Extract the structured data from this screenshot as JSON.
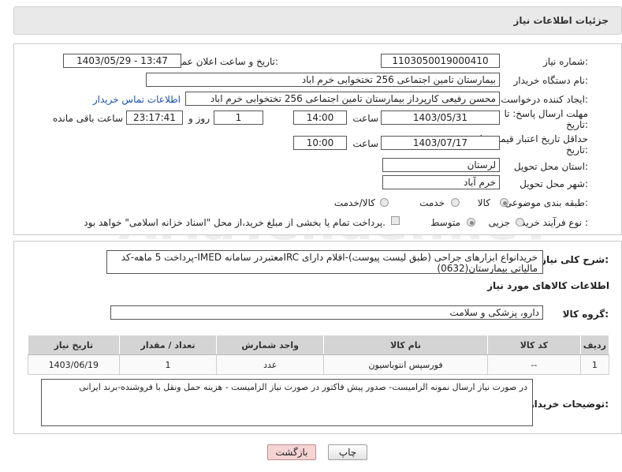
{
  "header": {
    "title": "جزئیات اطلاعات نیاز"
  },
  "form": {
    "need_number_label": "شماره نیاز:",
    "need_number": "1103050019000410",
    "announce_label": "تاریخ و ساعت اعلان عمومی:",
    "announce_value": "1403/05/29 - 13:47",
    "buyer_org_label": "نام دستگاه خریدار:",
    "buyer_org": "بیمارستان تامین اجتماعی  256 تختخوابی خرم اباد",
    "creator_label": "ایجاد کننده درخواست:",
    "creator": "محسن رفیعی کارپرداز بیمارستان تامین اجتماعی  256 تختخوابی خرم اباد",
    "contact_link": "اطلاعات تماس خریدار",
    "deadline_label_1": "مهلت ارسال پاسخ: تا",
    "deadline_label_2": "تاریخ:",
    "deadline_date": "1403/05/31",
    "time_label": "ساعت",
    "deadline_time": "14:00",
    "days_value": "1",
    "days_label": "روز و",
    "remaining_time": "23:17:41",
    "remaining_label": "ساعت باقی مانده",
    "validity_label_1": "حداقل تاریخ اعتبار قیمت: تا",
    "validity_label_2": "تاریخ:",
    "validity_date": "1403/07/17",
    "validity_time": "10:00",
    "province_label": "استان محل تحویل:",
    "province": "لرستان",
    "city_label": "شهر محل تحویل:",
    "city": "خرم آباد",
    "category_label": "طبقه بندی موضوعی:",
    "category_options": [
      "کالا",
      "خدمت",
      "کالا/خدمت"
    ],
    "process_label": "نوع فرآیند خرید :",
    "process_options": [
      "جزیی",
      "متوسط"
    ],
    "payment_note": "پرداخت تمام یا بخشی از مبلغ خرید،از محل \"اسناد خزانه اسلامی\" خواهد بود."
  },
  "description": {
    "label": "شرح کلی نیاز:",
    "text": "خریدانواع ابزارهای جراحی (طبق لیست پیوست)-اقلام دارای IRCمعتبردر سامانه IMED-پرداخت 5 ماهه-کد مالیاتی بیمارستان(0632)"
  },
  "goods": {
    "section_title": "اطلاعات کالاهای مورد نیاز",
    "group_label": "گروه کالا:",
    "group_value": "دارو، پزشکی و سلامت",
    "columns": [
      "ردیف",
      "کد کالا",
      "نام کالا",
      "واحد شمارش",
      "تعداد / مقدار",
      "تاریخ نیاز"
    ],
    "rows": [
      {
        "index": "1",
        "code": "--",
        "name": "فورسپس انتوباسیون",
        "unit": "عدد",
        "qty": "1",
        "date": "1403/06/19"
      }
    ]
  },
  "buyer_notes": {
    "label": "توضیحات خریدار:",
    "text": "در صورت نیاز ارسال نمونه الزامیست- صدور پیش فاکتور در صورت نیاز الزامیست - هزینه حمل ونقل با فروشنده-برند ایرانی"
  },
  "buttons": {
    "print": "چاپ",
    "back": "بازگشت"
  },
  "watermark": "AriaTender.neT"
}
